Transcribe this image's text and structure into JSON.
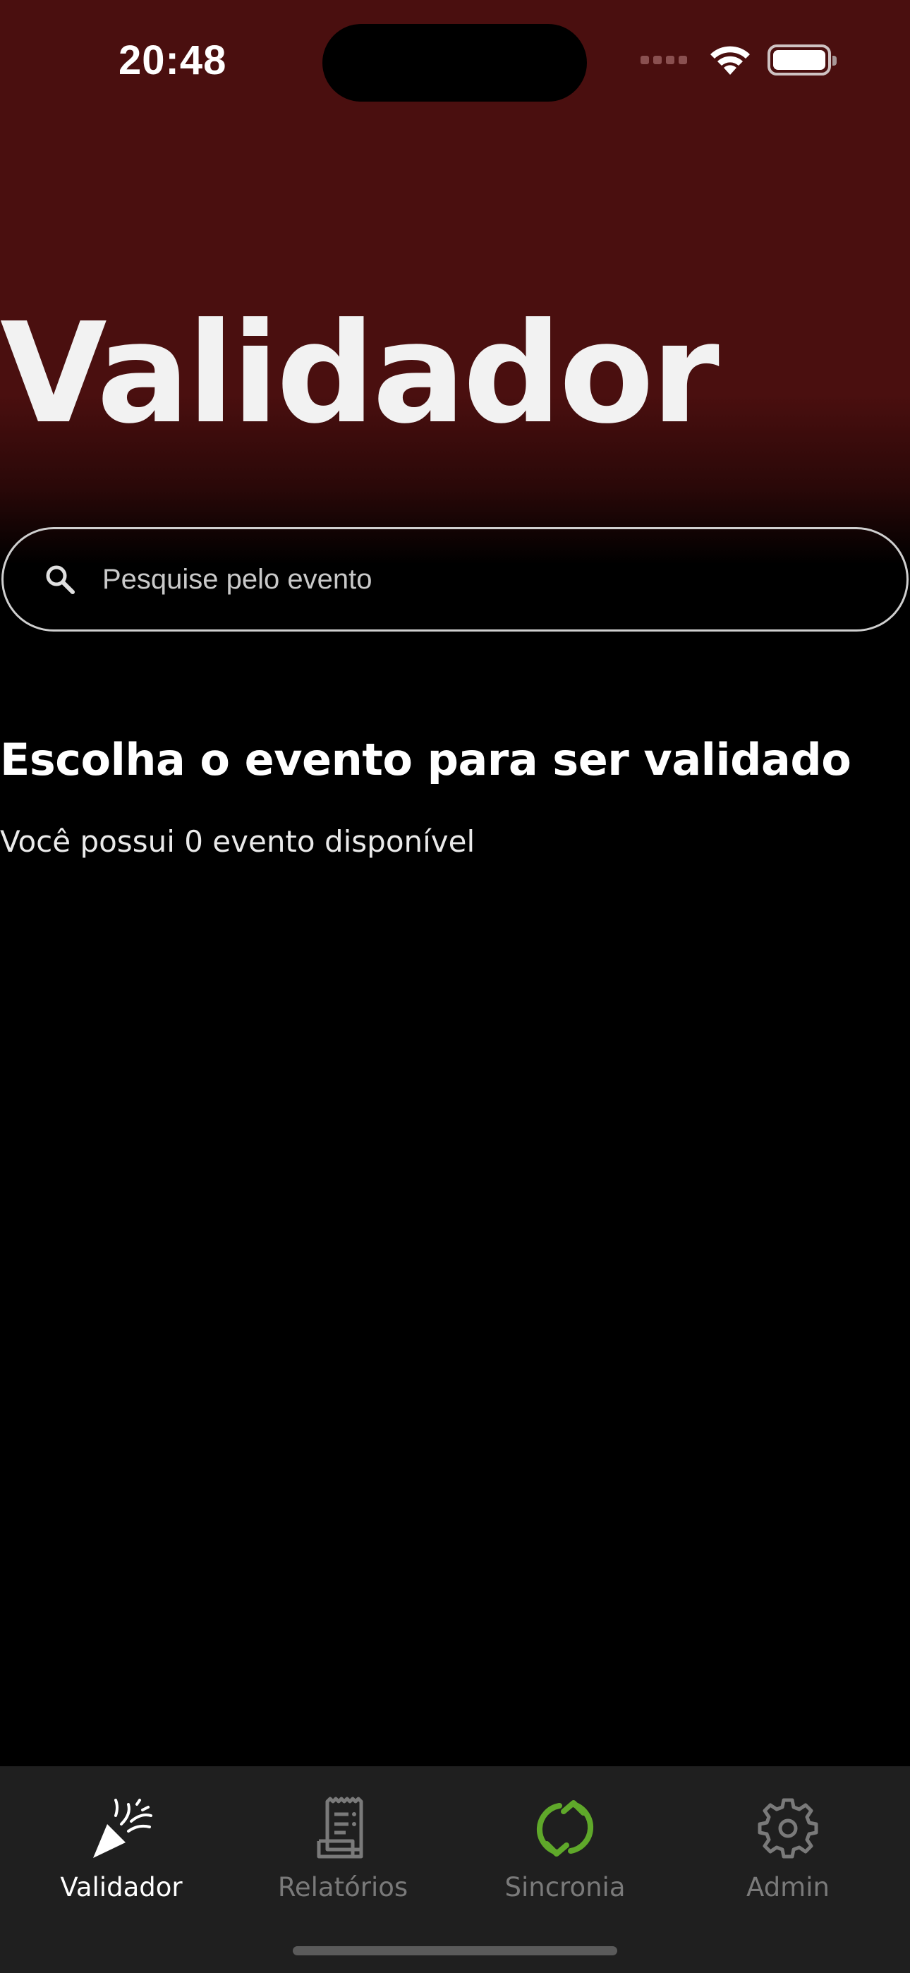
{
  "status_bar": {
    "time": "20:48"
  },
  "header": {
    "title": "Validador"
  },
  "search": {
    "placeholder": "Pesquise pelo evento"
  },
  "content": {
    "section_title": "Escolha o evento para ser validado",
    "section_subtitle": "Você possui 0 evento disponível"
  },
  "tabs": [
    {
      "label": "Validador",
      "icon": "party-popper-icon",
      "active": true
    },
    {
      "label": "Relatórios",
      "icon": "receipt-icon",
      "active": false
    },
    {
      "label": "Sincronia",
      "icon": "sync-icon",
      "active": false
    },
    {
      "label": "Admin",
      "icon": "gear-icon",
      "active": false
    }
  ],
  "colors": {
    "header_background": "#4a0f0f",
    "sync_accent": "#5fa82a",
    "tabbar_background": "#1f1f1f"
  }
}
